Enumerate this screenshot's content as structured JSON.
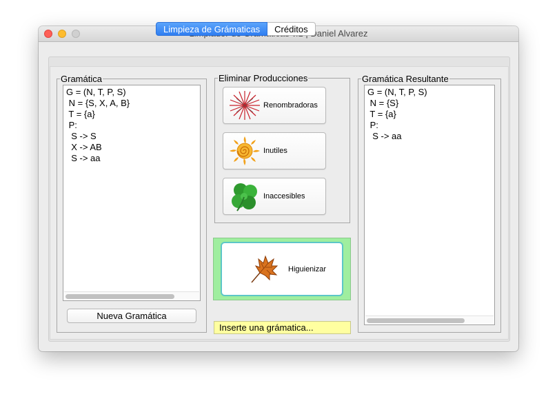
{
  "window": {
    "title": "Limpiador de Grámaticas v.1  |  Daniel Alvarez"
  },
  "tabs": [
    {
      "label": "Limpieza de Grámaticas",
      "active": true
    },
    {
      "label": "Créditos",
      "active": false
    }
  ],
  "left": {
    "legend": "Gramática",
    "lines": [
      "G = (N, T, P, S)",
      " N = {S, X, A, B}",
      " T = {a}",
      " P:",
      "  S -> S",
      "  X -> AB",
      "  S -> aa"
    ],
    "button": "Nueva Gramática"
  },
  "middle": {
    "legend": "Eliminar Producciones",
    "buttons": [
      {
        "label": "Renombradoras",
        "icon": "firework-icon"
      },
      {
        "label": "Inutiles",
        "icon": "sun-icon"
      },
      {
        "label": "Inaccesibles",
        "icon": "clover-icon"
      }
    ],
    "clean_button": {
      "label": "Higuienizar",
      "icon": "leaf-icon"
    },
    "status": "Inserte una grámatica..."
  },
  "right": {
    "legend": "Gramática Resultante",
    "lines": [
      "G = (N, T, P, S)",
      " N = {S}",
      " T = {a}",
      " P:",
      "  S -> aa"
    ]
  },
  "colors": {
    "tab_active": "#2f7ef1",
    "status_bg": "#ffffa0",
    "green_panel": "#9fee9f",
    "button_ring": "#5cc6c8"
  }
}
